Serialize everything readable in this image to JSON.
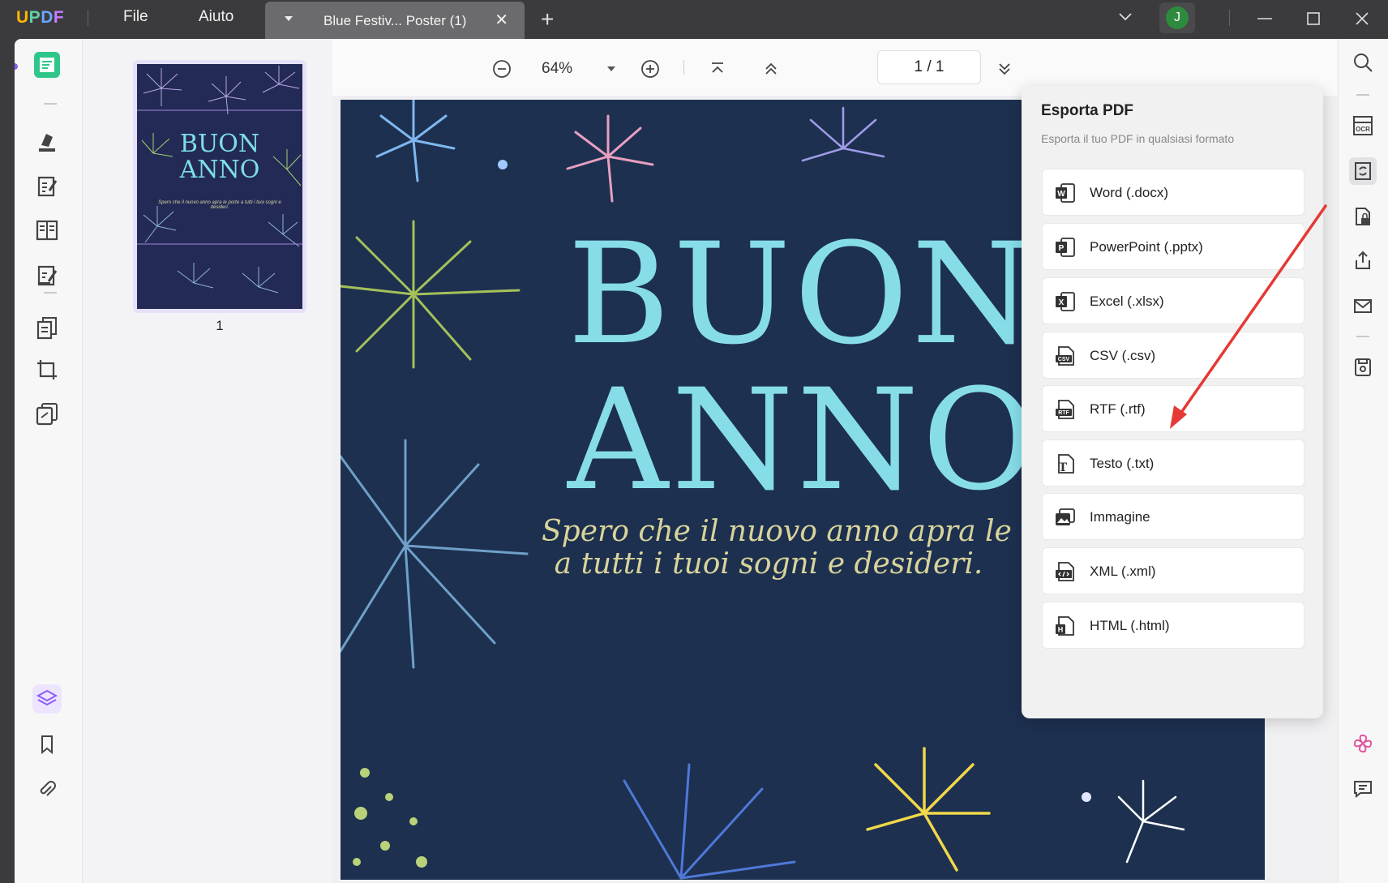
{
  "titlebar": {
    "logo": [
      "U",
      "P",
      "D",
      "F"
    ],
    "menu": [
      {
        "label": "File"
      },
      {
        "label": "Aiuto"
      }
    ],
    "tab_title": "Blue Festiv... Poster (1)",
    "avatar_letter": "J"
  },
  "thumbnails": {
    "page_label": "1",
    "title_line1": "BUON",
    "title_line2": "ANNO",
    "caption": "Spero che il nuovo anno apra le porte a tutti i tuoi sogni e desideri."
  },
  "toolbar": {
    "zoom": "64%",
    "page_indicator": "1  /  1"
  },
  "document": {
    "title_line1": "BUON",
    "title_line2": "ANNO",
    "script_line1": "Spero che il nuovo anno apra le po",
    "script_line2": "a tutti i tuoi sogni e desideri."
  },
  "export_panel": {
    "title": "Esporta PDF",
    "subtitle": "Esporta il tuo PDF in qualsiasi formato",
    "items": [
      {
        "label": "Word (.docx)",
        "icon": "word-icon"
      },
      {
        "label": "PowerPoint (.pptx)",
        "icon": "powerpoint-icon"
      },
      {
        "label": "Excel (.xlsx)",
        "icon": "excel-icon"
      },
      {
        "label": "CSV (.csv)",
        "icon": "csv-icon"
      },
      {
        "label": "RTF (.rtf)",
        "icon": "rtf-icon"
      },
      {
        "label": "Testo (.txt)",
        "icon": "text-icon"
      },
      {
        "label": "Immagine",
        "icon": "image-icon"
      },
      {
        "label": "XML (.xml)",
        "icon": "xml-icon"
      },
      {
        "label": "HTML (.html)",
        "icon": "html-icon"
      }
    ]
  },
  "colors": {
    "annotation_arrow": "#e53935",
    "poster_background": "#1d3050",
    "poster_title": "#86dde8",
    "poster_script": "#d8d49a",
    "avatar": "#2e8b3e"
  }
}
